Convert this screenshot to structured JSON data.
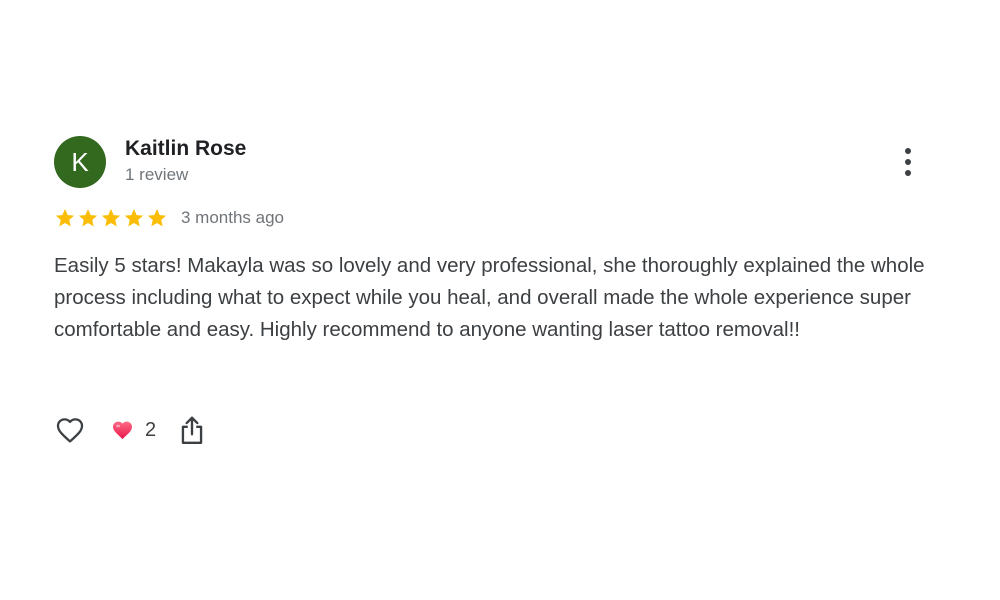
{
  "review": {
    "author": {
      "initial": "K",
      "name": "Kaitlin Rose",
      "meta": "1 review",
      "avatar_color": "#33691e"
    },
    "more_options_icon": "more-vertical-icon",
    "rating": {
      "stars": 5,
      "max": 5,
      "star_color": "#fbbc04"
    },
    "date": "3 months ago",
    "text": "Easily 5 stars! Makayla was so lovely and very professional, she thoroughly explained the whole process including what to expect while you heal, and overall made the whole experience super comfortable and easy. Highly recommend to anyone wanting laser tattoo removal!!",
    "actions": {
      "like_icon": "heart-outline-icon",
      "reaction_icon": "heart-filled-icon",
      "reaction_count": "2",
      "share_icon": "share-icon"
    }
  }
}
